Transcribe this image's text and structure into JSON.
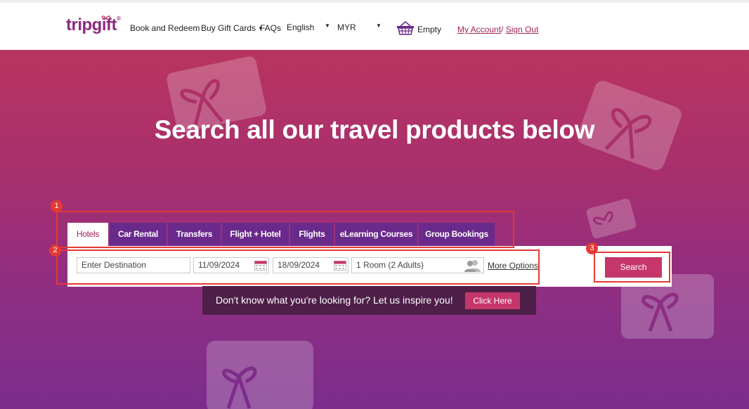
{
  "header": {
    "logo": "tripgift",
    "nav": {
      "book_redeem": "Book and Redeem",
      "buy_gift_cards": "Buy Gift Cards",
      "faqs": "FAQs",
      "language": "English",
      "currency": "MYR",
      "cart": "Empty"
    },
    "account": {
      "my_account": "My Account",
      "separator": "/",
      "sign_out": "Sign Out"
    }
  },
  "hero": {
    "headline": "Search all our travel products below"
  },
  "tabs": [
    {
      "label": "Hotels",
      "active": true
    },
    {
      "label": "Car Rental"
    },
    {
      "label": "Transfers"
    },
    {
      "label": "Flight + Hotel"
    },
    {
      "label": "Flights"
    },
    {
      "label": "eLearning Courses"
    },
    {
      "label": "Group Bookings"
    }
  ],
  "search": {
    "destination_placeholder": "Enter Destination",
    "checkin": "11/09/2024",
    "checkout": "18/09/2024",
    "rooms": "1 Room (2 Adults)",
    "more_options": "More Options",
    "button": "Search"
  },
  "inspire": {
    "text": "Don't know what you're looking for? Let us inspire you!",
    "button": "Click Here"
  },
  "annotations": [
    "1",
    "2",
    "3"
  ],
  "colors": {
    "brand": "#8d2a7e",
    "accent": "#c5366a",
    "tab": "#6a2a8c",
    "annotation": "#e53935"
  }
}
